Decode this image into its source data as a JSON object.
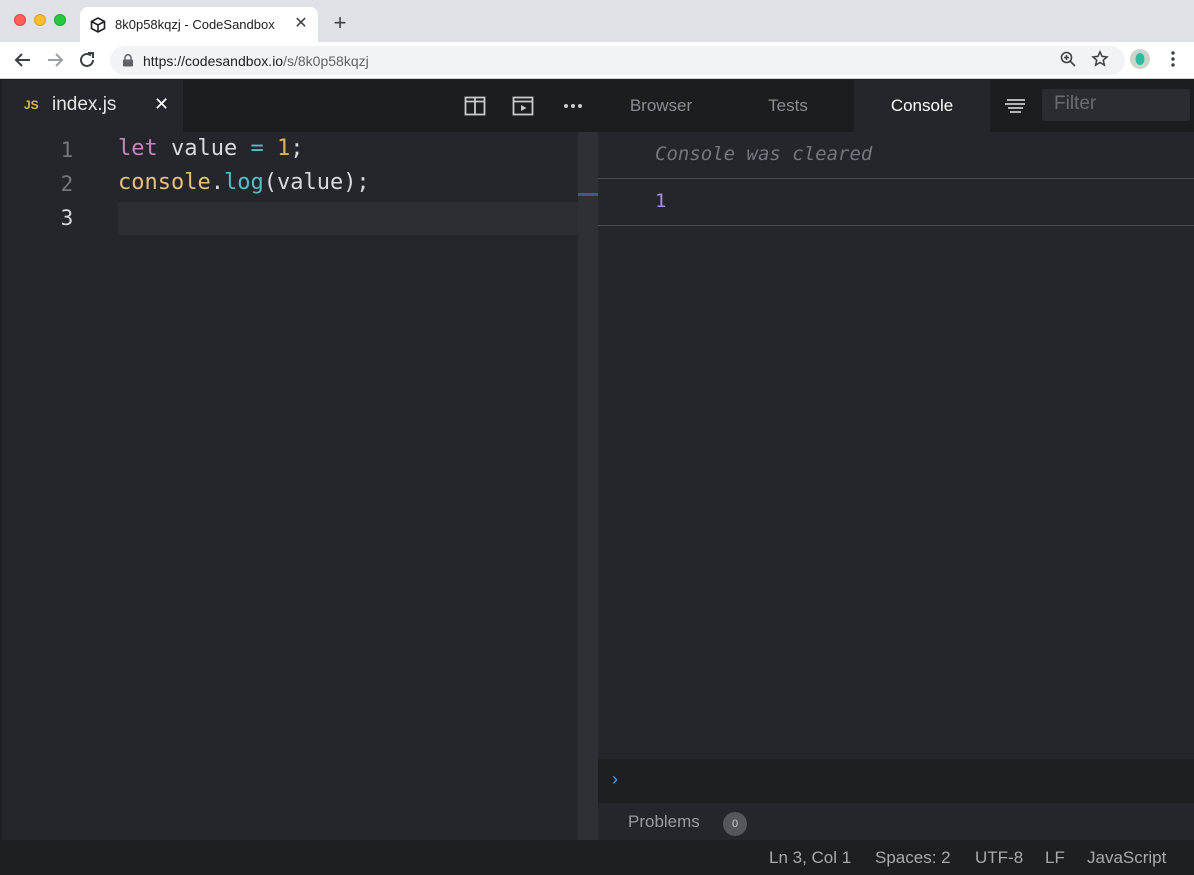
{
  "browser": {
    "tab_title": "8k0p58kqzj - CodeSandbox",
    "tab_close": "✕",
    "new_tab": "+",
    "url_host": "https://codesandbox.io",
    "url_path": "/s/8k0p58kqzj"
  },
  "editor": {
    "file_badge": "JS",
    "file_name": "index.js",
    "file_close": "✕",
    "line_numbers": [
      "1",
      "2",
      "3"
    ],
    "code": {
      "line1": {
        "kw": "let",
        "var": "value",
        "op": "=",
        "num": "1",
        "semi": ";"
      },
      "line2": {
        "obj": "console",
        "dot": ".",
        "fn": "log",
        "args": "(value);"
      }
    }
  },
  "panel": {
    "tabs": [
      "Browser",
      "Tests",
      "Console"
    ],
    "active_tab": "Console",
    "filter_placeholder": "Filter",
    "console_cleared": "Console was cleared",
    "console_output": "1",
    "prompt": "›",
    "problems_label": "Problems",
    "problems_count": "0"
  },
  "status": {
    "position": "Ln 3, Col 1",
    "spaces": "Spaces: 2",
    "encoding": "UTF-8",
    "eol": "LF",
    "language": "JavaScript"
  },
  "colors": {
    "accent_blue": "#3f9cf5",
    "js_badge": "#d6c13e"
  }
}
